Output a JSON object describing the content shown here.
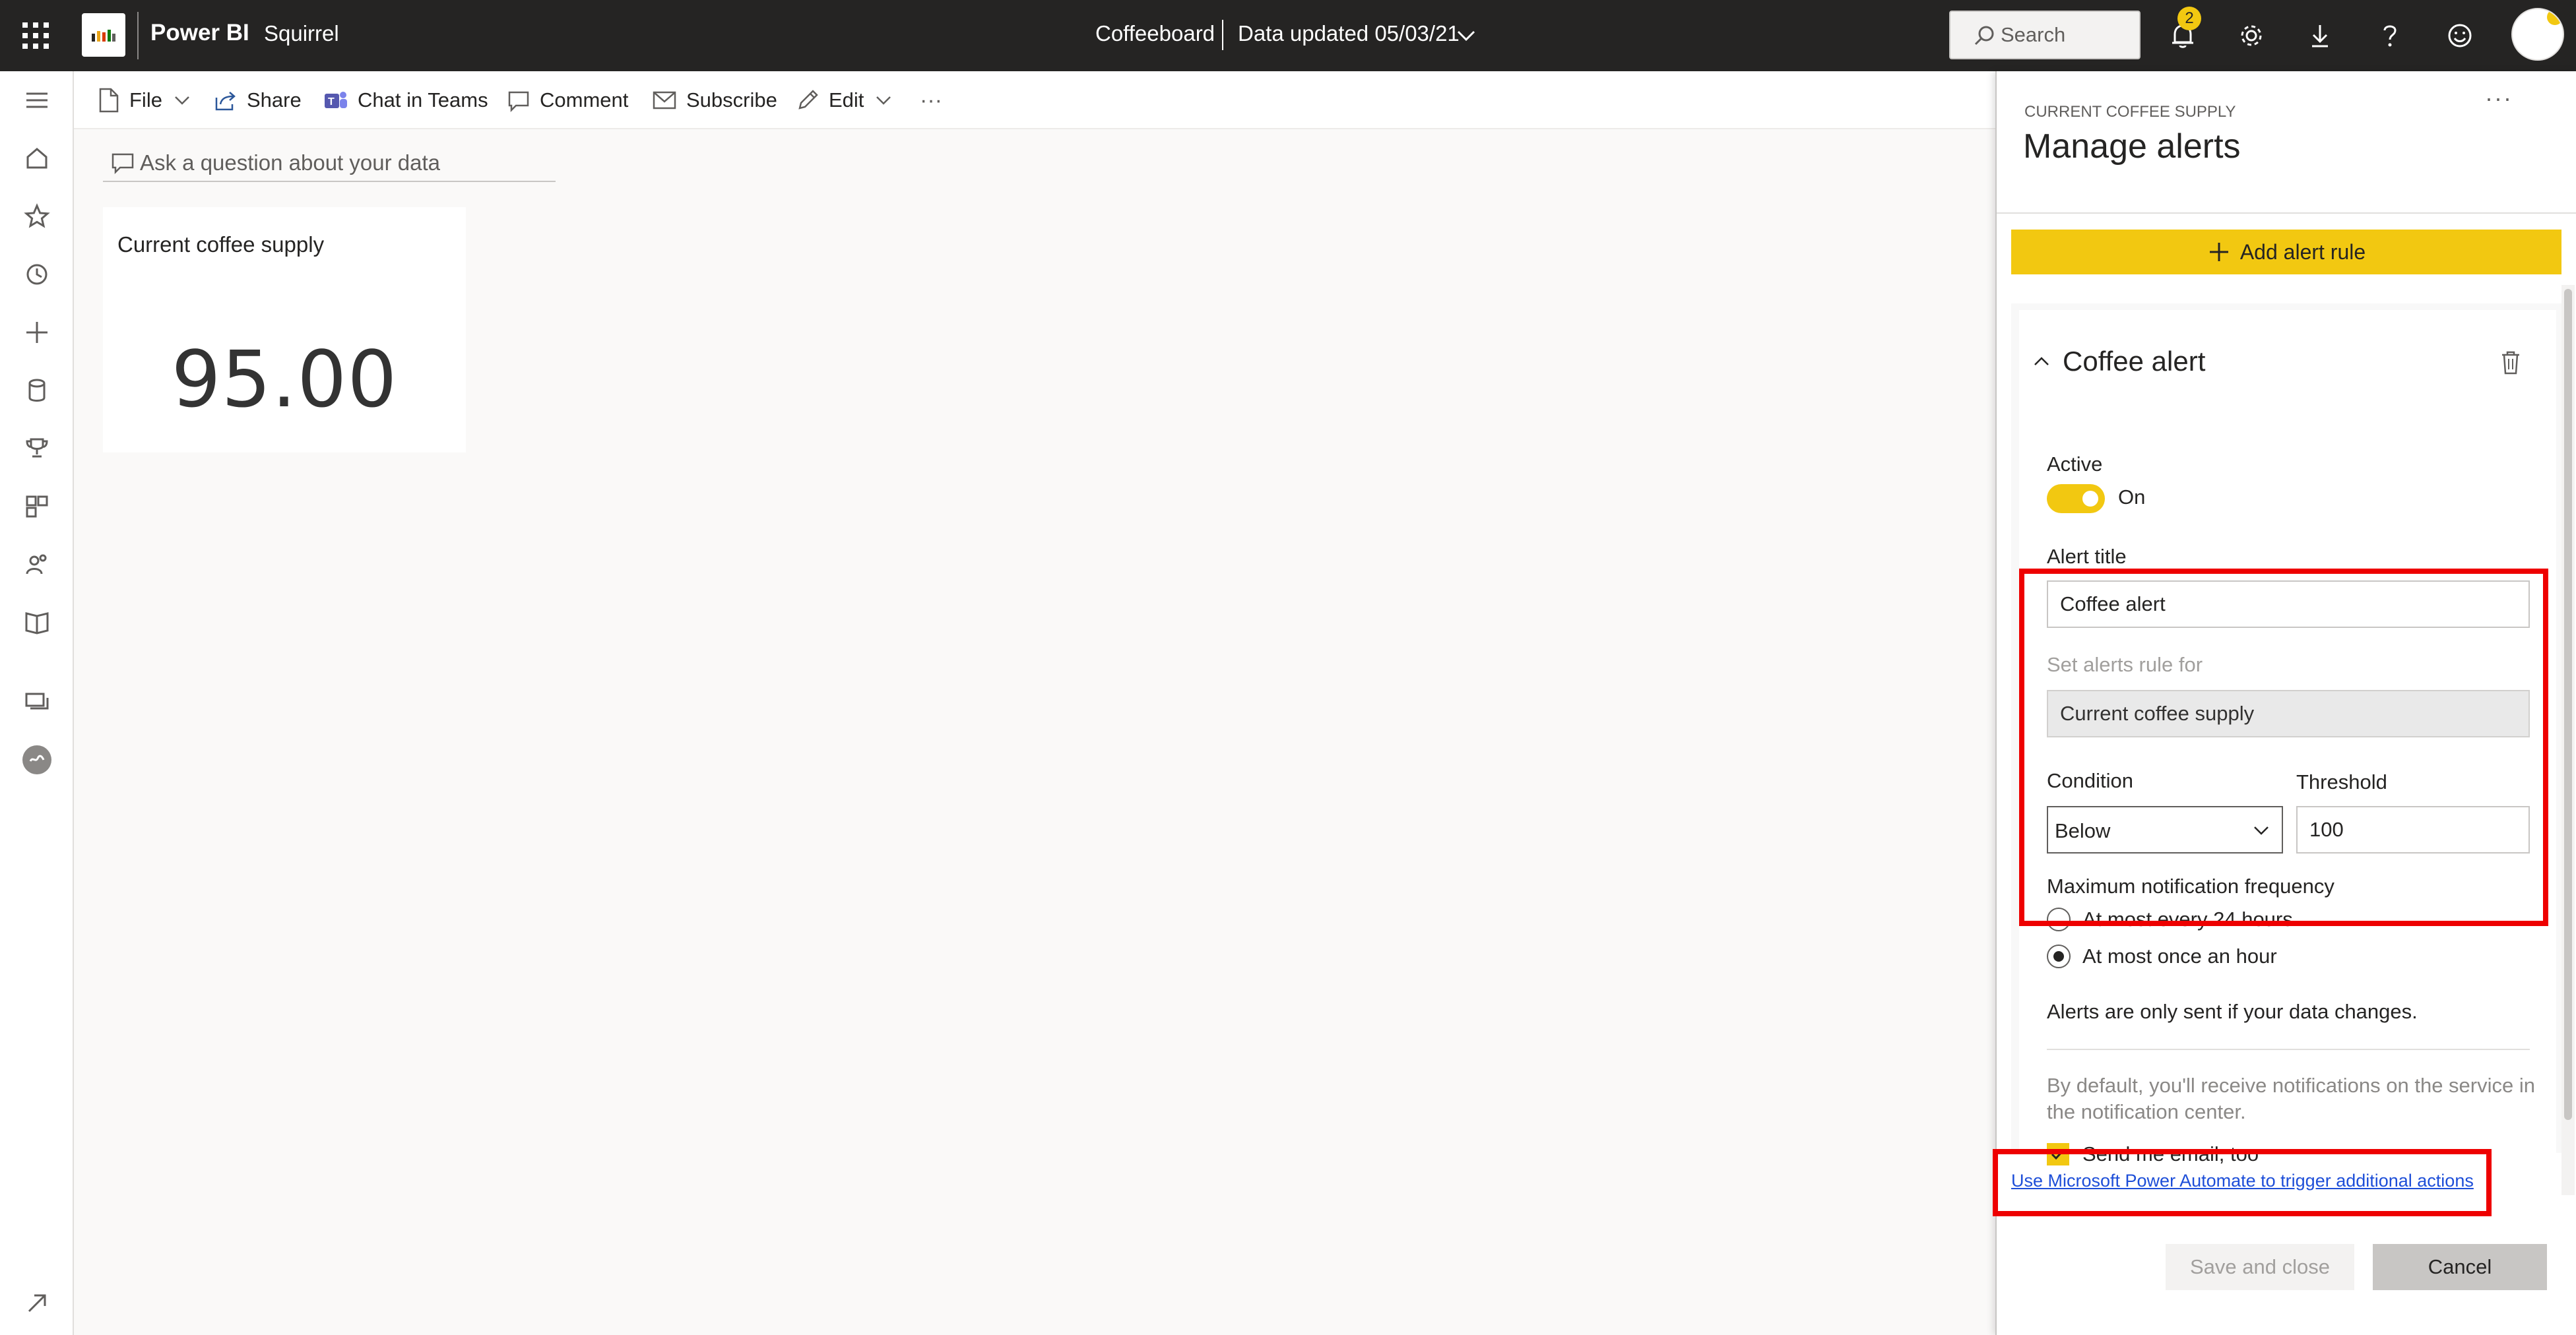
{
  "header": {
    "brand": "Power BI",
    "workspace": "Squirrel",
    "report_title": "Coffeeboard",
    "data_updated": "Data updated 05/03/21",
    "search_placeholder": "Search",
    "notification_count": "2"
  },
  "toolbar": {
    "file": "File",
    "share": "Share",
    "chat_in_teams": "Chat in Teams",
    "comment": "Comment",
    "subscribe": "Subscribe",
    "edit": "Edit",
    "more": "···"
  },
  "qna": {
    "placeholder": "Ask a question about your data"
  },
  "tile": {
    "title": "Current coffee supply",
    "value": "95.00"
  },
  "pane": {
    "more": "···",
    "subtitle": "CURRENT COFFEE SUPPLY",
    "title": "Manage alerts",
    "add_rule_label": "Add alert rule",
    "rule": {
      "name": "Coffee alert",
      "active_label": "Active",
      "toggle_state": "On",
      "alert_title_label": "Alert title",
      "alert_title_value": "Coffee alert",
      "set_rule_for_label": "Set alerts rule for",
      "set_rule_for_value": "Current coffee supply",
      "condition_label": "Condition",
      "condition_value": "Below",
      "threshold_label": "Threshold",
      "threshold_value": "100",
      "frequency_label": "Maximum notification frequency",
      "frequency_options": [
        "At most every 24 hours",
        "At most once an hour"
      ],
      "frequency_selected": "At most once an hour",
      "data_change_note": "Alerts are only sent if your data changes.",
      "default_note": "By default, you'll receive notifications on the service in the notification center.",
      "email_label": "Send me email, too",
      "email_checked": true
    },
    "automate_link": "Use Microsoft Power Automate to trigger additional actions",
    "save_label": "Save and close",
    "cancel_label": "Cancel"
  },
  "colors": {
    "accent": "#f2c811",
    "topbar": "#252423",
    "highlight": "#ee0000",
    "link": "#1d4ed8"
  }
}
